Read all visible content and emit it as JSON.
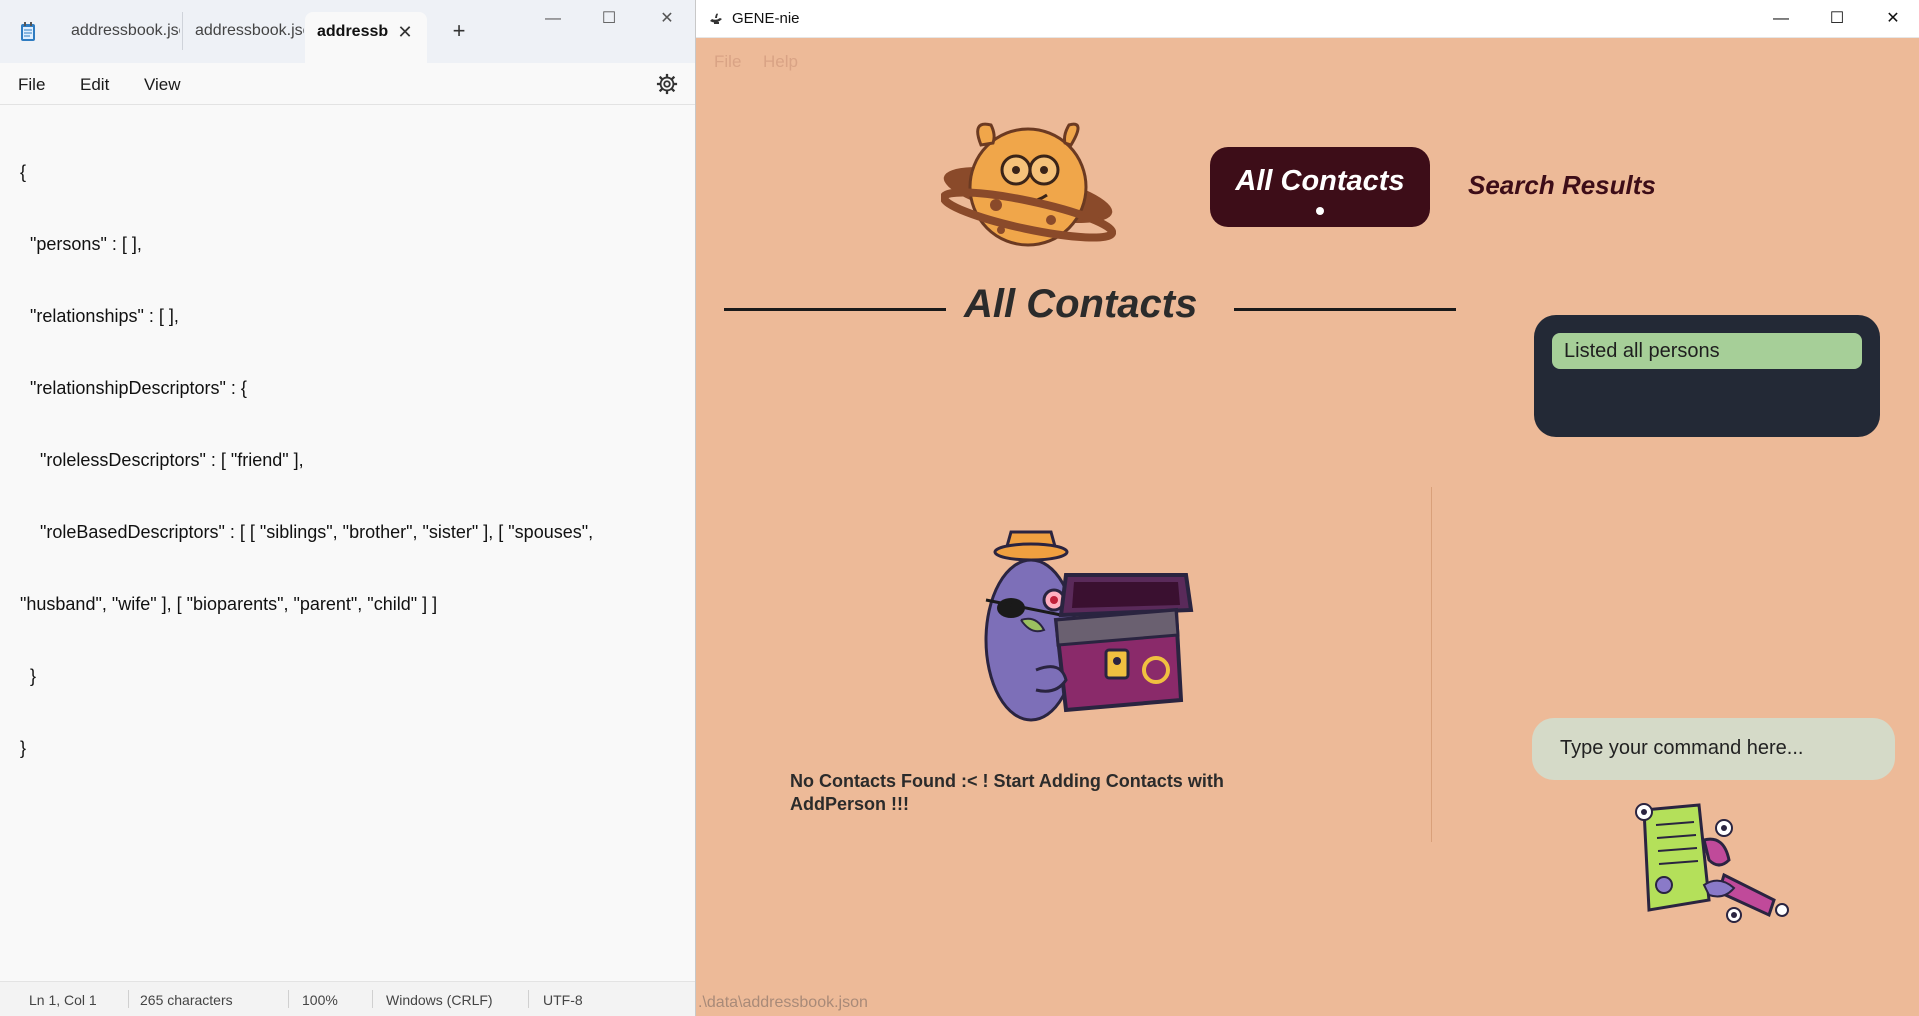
{
  "notepad": {
    "tabs": [
      "addressbook.jsc",
      "addressbook.jsc",
      "addressb"
    ],
    "menu": [
      "File",
      "Edit",
      "View"
    ],
    "lines": [
      "{",
      "  \"persons\" : [ ],",
      "  \"relationships\" : [ ],",
      "  \"relationshipDescriptors\" : {",
      "    \"rolelessDescriptors\" : [ \"friend\" ],",
      "    \"roleBasedDescriptors\" : [ [ \"siblings\", \"brother\", \"sister\" ], [ \"spouses\",",
      "\"husband\", \"wife\" ], [ \"bioparents\", \"parent\", \"child\" ] ]",
      "  }",
      "}"
    ],
    "status": {
      "position": "Ln 1, Col 1",
      "characters": "265 characters",
      "zoom": "100%",
      "line_ending": "Windows (CRLF)",
      "encoding": "UTF-8"
    }
  },
  "app": {
    "window_title": "GENE-nie",
    "menu": [
      "File",
      "Help"
    ],
    "nav": {
      "all_contacts": "All Contacts",
      "search_results": "Search Results"
    },
    "heading": "All Contacts",
    "result_message": "Listed all persons",
    "empty_message": "No Contacts Found :< ! Start Adding Contacts with AddPerson !!!",
    "command": {
      "placeholder": "Type your command here..."
    },
    "status_path": ".\\data\\addressbook.json"
  }
}
